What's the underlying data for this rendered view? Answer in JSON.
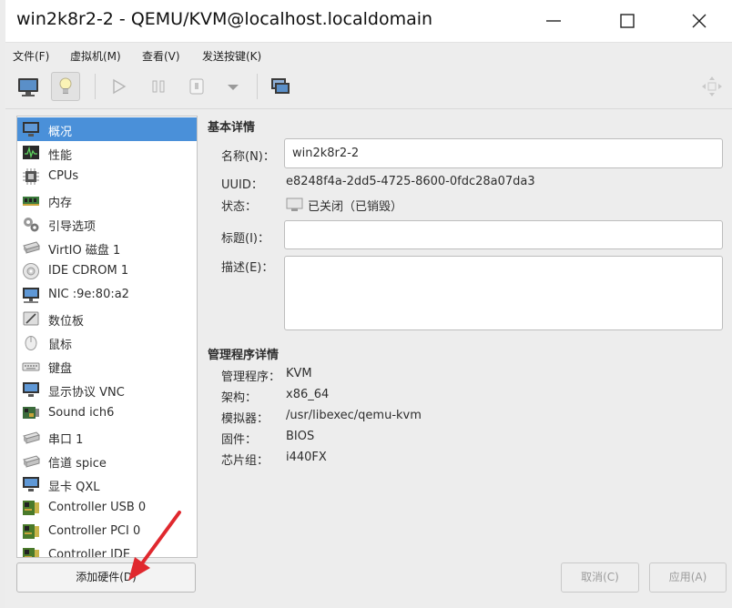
{
  "window": {
    "title": "win2k8r2-2 - QEMU/KVM@localhost.localdomain"
  },
  "menu": [
    "文件(F)",
    "虚拟机(M)",
    "查看(V)",
    "发送按键(K)"
  ],
  "toolbar": {
    "buttons": [
      "show-console",
      "show-details",
      "run",
      "pause",
      "shutdown",
      "shutdown-menu",
      "screenshots",
      "fullscreen"
    ],
    "active": "show-details"
  },
  "sidebar": {
    "items": [
      {
        "label": "概况",
        "icon": "overview-monitor-icon",
        "selected": true
      },
      {
        "label": "性能",
        "icon": "performance-graph-icon"
      },
      {
        "label": "CPUs",
        "icon": "cpu-chip-icon"
      },
      {
        "label": "内存",
        "icon": "memory-module-icon"
      },
      {
        "label": "引导选项",
        "icon": "boot-options-gears-icon"
      },
      {
        "label": "VirtIO 磁盘 1",
        "icon": "disk-drive-icon"
      },
      {
        "label": "IDE CDROM 1",
        "icon": "cdrom-disc-icon"
      },
      {
        "label": "NIC :9e:80:a2",
        "icon": "network-nic-icon"
      },
      {
        "label": "数位板",
        "icon": "tablet-icon"
      },
      {
        "label": "鼠标",
        "icon": "mouse-icon"
      },
      {
        "label": "键盘",
        "icon": "keyboard-icon"
      },
      {
        "label": "显示协议 VNC",
        "icon": "display-vnc-icon"
      },
      {
        "label": "Sound ich6",
        "icon": "sound-card-icon"
      },
      {
        "label": "串口 1",
        "icon": "serial-port-icon"
      },
      {
        "label": "信道 spice",
        "icon": "channel-icon"
      },
      {
        "label": "显卡 QXL",
        "icon": "video-card-icon"
      },
      {
        "label": "Controller USB 0",
        "icon": "controller-board-icon"
      },
      {
        "label": "Controller PCI 0",
        "icon": "controller-board-icon"
      },
      {
        "label": "Controller IDE",
        "icon": "controller-board-icon"
      }
    ],
    "add_hardware": "添加硬件(D)"
  },
  "details": {
    "basic_title": "基本详情",
    "name_label": "名称(N)：",
    "name_value": "win2k8r2-2",
    "uuid_label": "UUID：",
    "uuid_value": "e8248f4a-2dd5-4725-8600-0fdc28a07da3",
    "status_label": "状态：",
    "status_value": "已关闭（已销毁）",
    "title_label": "标题(I)：",
    "title_value": "",
    "desc_label": "描述(E)：",
    "desc_value": "",
    "hyper_title": "管理程序详情",
    "hypervisor_label": "管理程序：",
    "hypervisor_value": "KVM",
    "arch_label": "架构：",
    "arch_value": "x86_64",
    "emulator_label": "模拟器：",
    "emulator_value": "/usr/libexec/qemu-kvm",
    "firmware_label": "固件：",
    "firmware_value": "BIOS",
    "chipset_label": "芯片组：",
    "chipset_value": "i440FX"
  },
  "footer": {
    "cancel": "取消(C)",
    "apply": "应用(A)"
  },
  "colors": {
    "accent": "#4a90d9",
    "annotation_arrow": "#e0282e"
  }
}
